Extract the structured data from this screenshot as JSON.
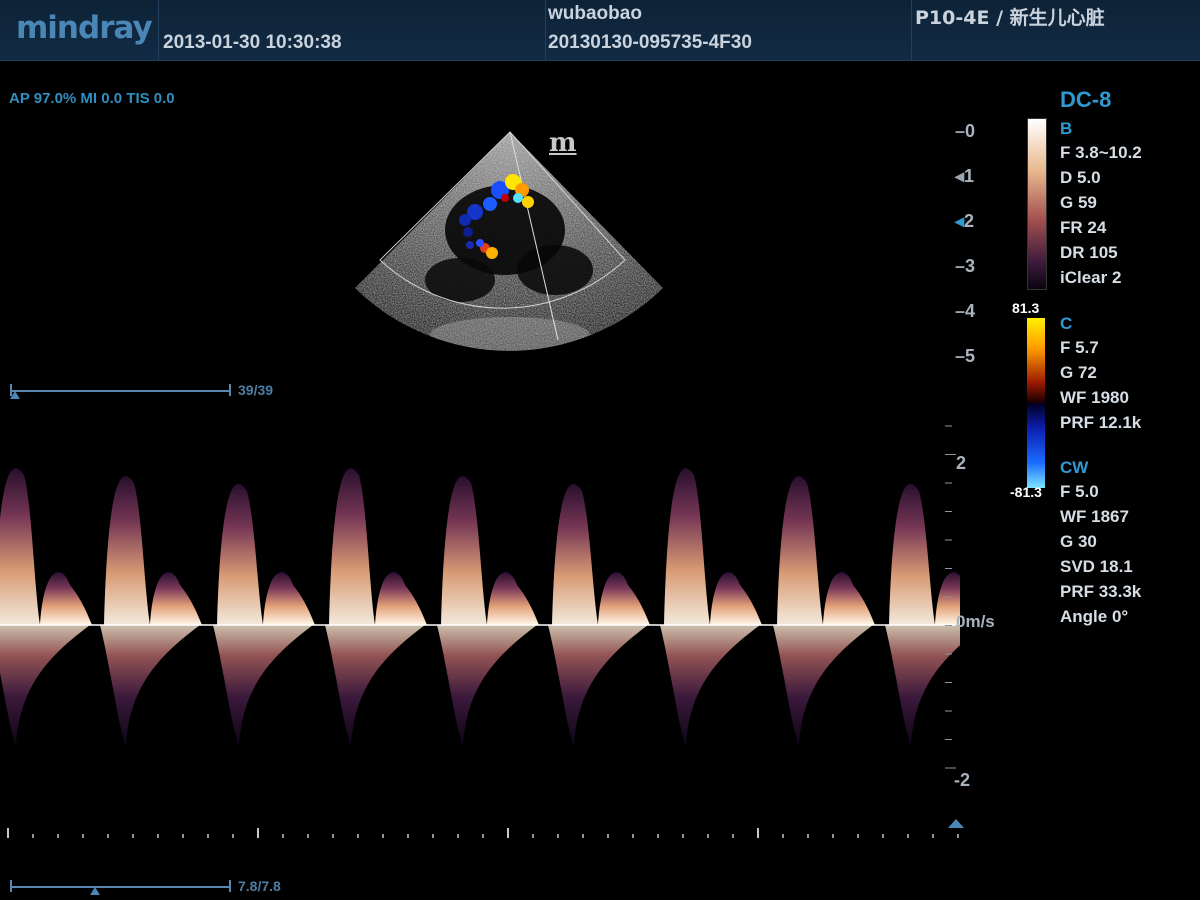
{
  "header": {
    "brand": "mindray",
    "datetime": "2013-01-30  10:30:38",
    "patient_name": "wubaobao",
    "exam_id": "20130130-095735-4F30",
    "probe_preset": "P10-4E / 新生儿心脏"
  },
  "acoustic_output": "AP 97.0%  MI 0.0 TIS 0.0",
  "depth_scale": [
    "0",
    "1",
    "2",
    "3",
    "4",
    "5"
  ],
  "panel": {
    "mode": "DC-8",
    "b_title": "B",
    "b_params": [
      "F 3.8~10.2",
      "D 5.0",
      "G 59",
      "FR 24",
      "DR 105",
      "iClear 2"
    ],
    "c_max": "81.3",
    "c_min": "-81.3",
    "c_title": "C",
    "c_params": [
      "F 5.7",
      "G 72",
      "WF 1980",
      "PRF 12.1k"
    ],
    "cw_title": "CW",
    "cw_params": [
      "F 5.0",
      "WF 1867",
      "G 30",
      "SVD 18.1",
      "PRF 33.3k",
      "Angle  0°"
    ]
  },
  "cine_top": {
    "label": "39/39",
    "position": 1.0
  },
  "cine_bottom": {
    "label": "7.8/7.8",
    "position": 0.375
  },
  "doppler": {
    "baseline_label": "0m/s",
    "scale_labels": [
      "2",
      "-2"
    ]
  },
  "colors": {
    "accent": "#2f9ad2",
    "header_bg": "#122b44",
    "brand": "#4a86b6"
  }
}
